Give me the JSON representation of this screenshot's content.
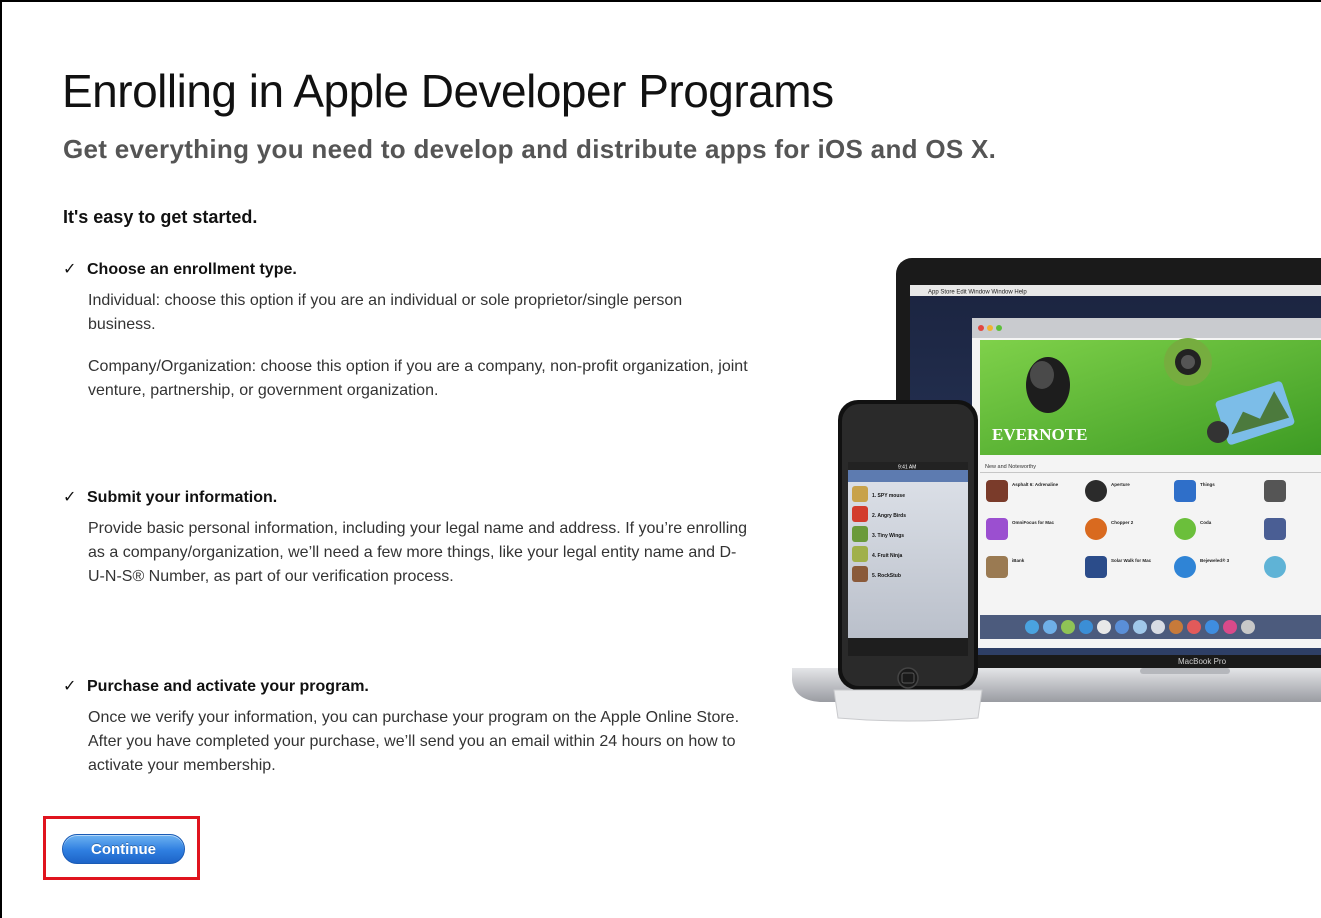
{
  "page": {
    "title": "Enrolling in Apple Developer Programs",
    "subtitle": "Get everything you need to develop and distribute apps for iOS and OS X.",
    "intro_heading": "It's easy to get started."
  },
  "steps": [
    {
      "heading": "Choose an enrollment type.",
      "paragraphs": [
        "Individual: choose this option if you are an individual or sole proprietor/single person business.",
        "Company/Organization: choose this option if you are a company, non-profit organization, joint venture, partnership, or government organization."
      ]
    },
    {
      "heading": "Submit your information.",
      "paragraphs": [
        "Provide basic personal information, including your legal name and address. If you’re enrolling as a company/organization, we’ll need a few more things, like your legal entity name and D-U-N-S® Number, as part of our verification process."
      ]
    },
    {
      "heading": "Purchase and activate your program.",
      "paragraphs": [
        "Once we verify your information, you can purchase your program on the Apple Online Store. After you have completed your purchase, we’ll send you an email within 24 hours on how to activate your membership."
      ]
    }
  ],
  "check_glyph": "✓",
  "continue_label": "Continue",
  "hero_image": {
    "menubar": "App Store  Edit  Window  Window  Help",
    "banner_text": "EVERNOTE",
    "section_label": "New and Noteworthy",
    "laptop_label": "MacBook Pro",
    "phone_time": "9:41 AM",
    "phone_rows": [
      "1. SPY mouse",
      "2. Angry Birds",
      "3. Tiny Wings",
      "4. Fruit Ninja",
      "5. RockStub"
    ],
    "apps": [
      "Asphalt 6: Adrenaline",
      "Aperture",
      "Things",
      "OmniFocus for Mac",
      "Chopper 2",
      "Coda",
      "iBank",
      "Solar Walk for Mac",
      "Bejeweled® 3"
    ]
  },
  "colors": {
    "accent": "#2f7ee0",
    "highlight": "#e0141e",
    "evernote_green": "#5cb530"
  }
}
